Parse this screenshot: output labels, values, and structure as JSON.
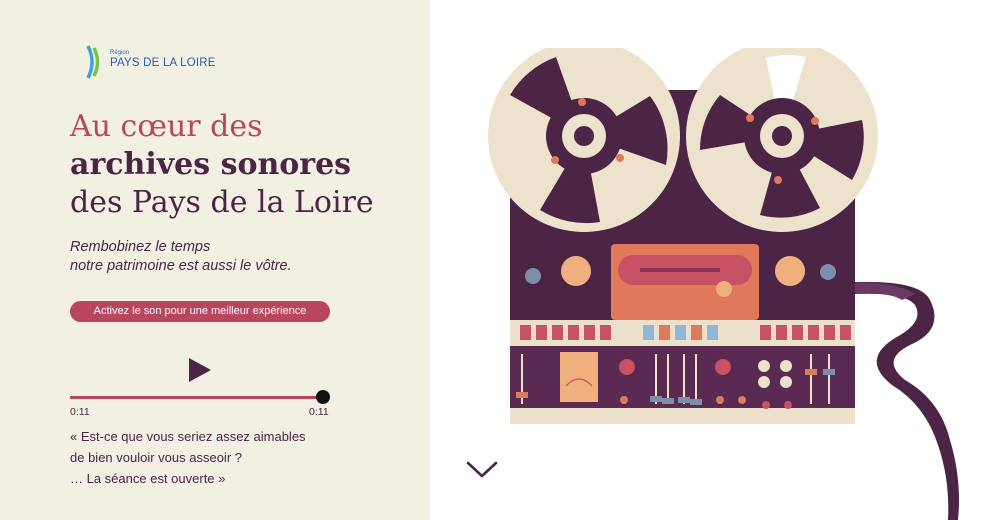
{
  "logo": {
    "small": "Région",
    "big": "PAYS DE LA LOIRE"
  },
  "hero": {
    "title_line1": "Au cœur des",
    "title_line2": "archives sonores",
    "title_line3": "des Pays de la Loire",
    "subtitle_line1": "Rembobinez le temps",
    "subtitle_line2": "notre patrimoine est aussi le vôtre."
  },
  "sound_button": {
    "label": "Activez le son pour une meilleur expérience"
  },
  "player": {
    "current_time": "0:11",
    "duration": "0:11",
    "progress": 1.0,
    "play_icon": "play-icon"
  },
  "quote": {
    "line1": "« Est-ce que vous seriez assez aimables",
    "line2": "de bien vouloir vous asseoir ?",
    "line3": "… La séance est ouverte »"
  },
  "scroll": {
    "icon": "chevron-down-icon"
  },
  "colors": {
    "left_background": "#f2f0e3",
    "accent": "#b8465f",
    "plum": "#4b2446",
    "reel": "#ede3cd",
    "orange": "#e0795a"
  },
  "illustration": {
    "icon": "reel-to-reel-tape-recorder-icon"
  }
}
